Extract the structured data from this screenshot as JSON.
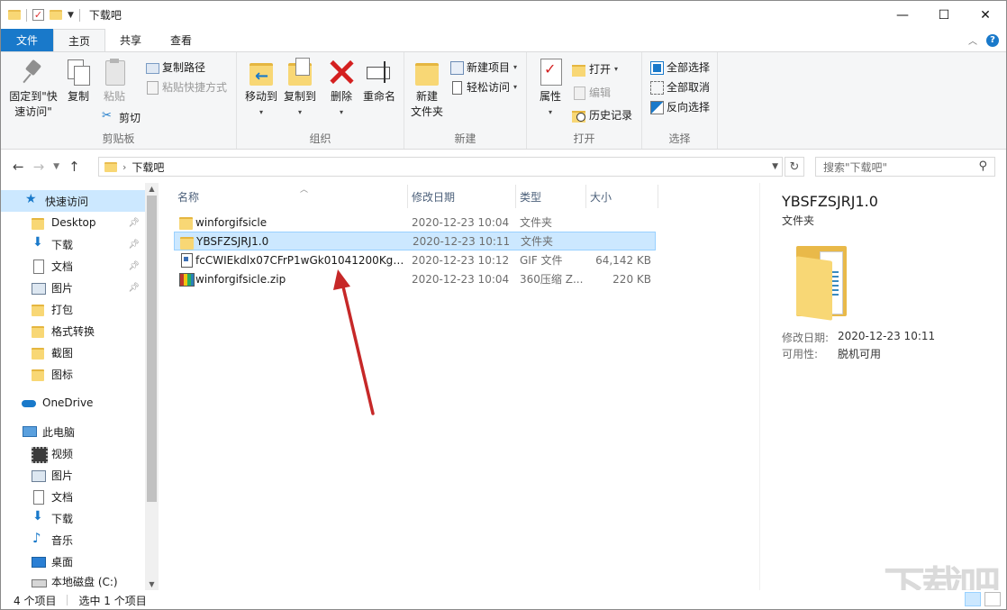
{
  "window": {
    "title": "下载吧",
    "controls": {
      "minimize": "—",
      "maximize": "☐",
      "close": "✕"
    }
  },
  "ribbon_tabs": [
    {
      "label": "文件"
    },
    {
      "label": "主页"
    },
    {
      "label": "共享"
    },
    {
      "label": "查看"
    }
  ],
  "ribbon": {
    "clipboard": {
      "label": "剪贴板",
      "pin": "固定到\"快\n速访问\"",
      "copy": "复制",
      "paste": "粘贴",
      "copy_path": "复制路径",
      "paste_shortcut": "粘贴快捷方式",
      "cut": "剪切"
    },
    "organize": {
      "label": "组织",
      "move_to": "移动到",
      "copy_to": "复制到",
      "delete": "删除",
      "rename": "重命名"
    },
    "new": {
      "label": "新建",
      "new_folder": "新建\n文件夹",
      "new_item": "新建项目",
      "easy_access": "轻松访问"
    },
    "open": {
      "label": "打开",
      "properties": "属性",
      "open": "打开",
      "edit": "编辑",
      "history": "历史记录"
    },
    "select": {
      "label": "选择",
      "select_all": "全部选择",
      "select_none": "全部取消",
      "invert": "反向选择"
    }
  },
  "address": {
    "path": "下载吧",
    "search_placeholder": "搜索\"下载吧\""
  },
  "nav": {
    "quick_access": "快速访问",
    "items": [
      {
        "label": "Desktop",
        "pinned": true
      },
      {
        "label": "下载",
        "pinned": true
      },
      {
        "label": "文档",
        "pinned": true
      },
      {
        "label": "图片",
        "pinned": true
      },
      {
        "label": "打包",
        "pinned": false
      },
      {
        "label": "格式转换",
        "pinned": false
      },
      {
        "label": "截图",
        "pinned": false
      },
      {
        "label": "图标",
        "pinned": false
      }
    ],
    "onedrive": "OneDrive",
    "this_pc": "此电脑",
    "pc_items": [
      {
        "label": "视频"
      },
      {
        "label": "图片"
      },
      {
        "label": "文档"
      },
      {
        "label": "下载"
      },
      {
        "label": "音乐"
      },
      {
        "label": "桌面"
      },
      {
        "label": "本地磁盘 (C:)"
      }
    ]
  },
  "columns": {
    "name": "名称",
    "date": "修改日期",
    "type": "类型",
    "size": "大小"
  },
  "files": [
    {
      "name": "winforgifsicle",
      "date": "2020-12-23 10:04",
      "type": "文件夹",
      "size": "",
      "icon": "folder-icon",
      "selected": false
    },
    {
      "name": "YBSFZSJRJ1.0",
      "date": "2020-12-23 10:11",
      "type": "文件夹",
      "size": "",
      "icon": "folder-icon",
      "selected": true
    },
    {
      "name": "fcCWIEkdlx07CFrP1wGk01041200Kgv...",
      "date": "2020-12-23 10:12",
      "type": "GIF 文件",
      "size": "64,142 KB",
      "icon": "gif-file-icon",
      "selected": false
    },
    {
      "name": "winforgifsicle.zip",
      "date": "2020-12-23 10:04",
      "type": "360压缩 Z...",
      "size": "220 KB",
      "icon": "zip-file-icon",
      "selected": false
    }
  ],
  "details": {
    "name": "YBSFZSJRJ1.0",
    "type": "文件夹",
    "modified_label": "修改日期:",
    "modified_value": "2020-12-23 10:11",
    "availability_label": "可用性:",
    "availability_value": "脱机可用"
  },
  "status": {
    "count": "4 个项目",
    "selected": "选中 1 个项目"
  },
  "watermark": "下载吧"
}
